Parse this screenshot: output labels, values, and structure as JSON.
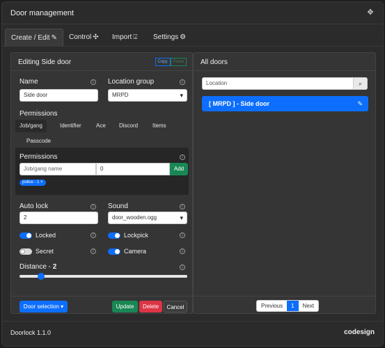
{
  "window": {
    "title": "Door management",
    "move_icon": "move-arrows-icon"
  },
  "tabs": [
    {
      "label": "Create / Edit",
      "icon": "pencil-square-icon"
    },
    {
      "label": "Control",
      "icon": "crosshair-icon"
    },
    {
      "label": "Import",
      "icon": "import-box-icon"
    },
    {
      "label": "Settings",
      "icon": "gear-icon"
    }
  ],
  "editor": {
    "title": "Editing Side door",
    "copy_label": "Copy",
    "paste_label": "Paste",
    "name_label": "Name",
    "name_value": "Side door",
    "location_group_label": "Location group",
    "location_group_value": "MRPD",
    "permissions_label": "Permissions",
    "permission_tabs": [
      "Job/gang",
      "Identifier",
      "Ace",
      "Discord",
      "Items",
      "Passcode"
    ],
    "permission_box_label": "Permissions",
    "job_placeholder": "Job/gang name",
    "grade_value": "0",
    "add_label": "Add",
    "badge_label": "police - 1",
    "badge_close": "×",
    "autolock_label": "Auto lock",
    "autolock_value": "2",
    "sound_label": "Sound",
    "sound_value": "door_wooden.ogg",
    "toggles": [
      {
        "label": "Locked",
        "on": true
      },
      {
        "label": "Lockpick",
        "on": true
      },
      {
        "label": "Secret",
        "on": false
      },
      {
        "label": "Camera",
        "on": true
      }
    ],
    "distance_label": "Distance - ",
    "distance_value": "2",
    "distance_fraction": 0.13,
    "door_selection_label": "Door selection",
    "update_label": "Update",
    "delete_label": "Delete",
    "cancel_label": "Cancel"
  },
  "doors": {
    "title": "All doors",
    "search_placeholder": "Location",
    "items": [
      {
        "label": "[ MRPD ] - Side door"
      }
    ],
    "pager": {
      "prev": "Previous",
      "current": "1",
      "next": "Next"
    }
  },
  "footer": {
    "version": "Doorlock 1.1.0",
    "brand": "codesign"
  },
  "colors": {
    "primary": "#0d6efd",
    "success": "#198754",
    "danger": "#dc3545",
    "background": "#2b2b2b"
  }
}
